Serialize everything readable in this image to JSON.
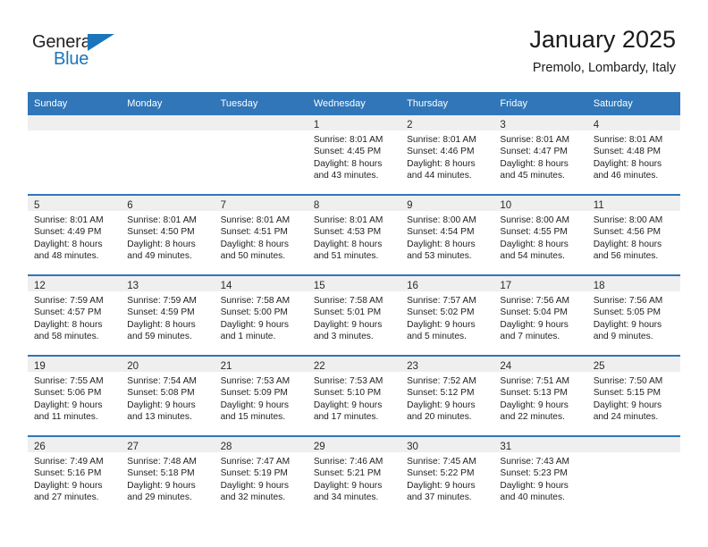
{
  "brand": {
    "name_part1": "General",
    "name_part2": "Blue",
    "logo_icon": "triangle-flag-icon",
    "accent_color": "#1b75bb"
  },
  "header": {
    "title": "January 2025",
    "location": "Premolo, Lombardy, Italy"
  },
  "theme": {
    "header_blue": "#3076b8",
    "daynum_band": "#efeff0",
    "text": "#1f1f1f"
  },
  "weekdays": [
    "Sunday",
    "Monday",
    "Tuesday",
    "Wednesday",
    "Thursday",
    "Friday",
    "Saturday"
  ],
  "weeks": [
    [
      {
        "day": "",
        "lines": [
          "",
          "",
          "",
          ""
        ]
      },
      {
        "day": "",
        "lines": [
          "",
          "",
          "",
          ""
        ]
      },
      {
        "day": "",
        "lines": [
          "",
          "",
          "",
          ""
        ]
      },
      {
        "day": "1",
        "lines": [
          "Sunrise: 8:01 AM",
          "Sunset: 4:45 PM",
          "Daylight: 8 hours",
          "and 43 minutes."
        ]
      },
      {
        "day": "2",
        "lines": [
          "Sunrise: 8:01 AM",
          "Sunset: 4:46 PM",
          "Daylight: 8 hours",
          "and 44 minutes."
        ]
      },
      {
        "day": "3",
        "lines": [
          "Sunrise: 8:01 AM",
          "Sunset: 4:47 PM",
          "Daylight: 8 hours",
          "and 45 minutes."
        ]
      },
      {
        "day": "4",
        "lines": [
          "Sunrise: 8:01 AM",
          "Sunset: 4:48 PM",
          "Daylight: 8 hours",
          "and 46 minutes."
        ]
      }
    ],
    [
      {
        "day": "5",
        "lines": [
          "Sunrise: 8:01 AM",
          "Sunset: 4:49 PM",
          "Daylight: 8 hours",
          "and 48 minutes."
        ]
      },
      {
        "day": "6",
        "lines": [
          "Sunrise: 8:01 AM",
          "Sunset: 4:50 PM",
          "Daylight: 8 hours",
          "and 49 minutes."
        ]
      },
      {
        "day": "7",
        "lines": [
          "Sunrise: 8:01 AM",
          "Sunset: 4:51 PM",
          "Daylight: 8 hours",
          "and 50 minutes."
        ]
      },
      {
        "day": "8",
        "lines": [
          "Sunrise: 8:01 AM",
          "Sunset: 4:53 PM",
          "Daylight: 8 hours",
          "and 51 minutes."
        ]
      },
      {
        "day": "9",
        "lines": [
          "Sunrise: 8:00 AM",
          "Sunset: 4:54 PM",
          "Daylight: 8 hours",
          "and 53 minutes."
        ]
      },
      {
        "day": "10",
        "lines": [
          "Sunrise: 8:00 AM",
          "Sunset: 4:55 PM",
          "Daylight: 8 hours",
          "and 54 minutes."
        ]
      },
      {
        "day": "11",
        "lines": [
          "Sunrise: 8:00 AM",
          "Sunset: 4:56 PM",
          "Daylight: 8 hours",
          "and 56 minutes."
        ]
      }
    ],
    [
      {
        "day": "12",
        "lines": [
          "Sunrise: 7:59 AM",
          "Sunset: 4:57 PM",
          "Daylight: 8 hours",
          "and 58 minutes."
        ]
      },
      {
        "day": "13",
        "lines": [
          "Sunrise: 7:59 AM",
          "Sunset: 4:59 PM",
          "Daylight: 8 hours",
          "and 59 minutes."
        ]
      },
      {
        "day": "14",
        "lines": [
          "Sunrise: 7:58 AM",
          "Sunset: 5:00 PM",
          "Daylight: 9 hours",
          "and 1 minute."
        ]
      },
      {
        "day": "15",
        "lines": [
          "Sunrise: 7:58 AM",
          "Sunset: 5:01 PM",
          "Daylight: 9 hours",
          "and 3 minutes."
        ]
      },
      {
        "day": "16",
        "lines": [
          "Sunrise: 7:57 AM",
          "Sunset: 5:02 PM",
          "Daylight: 9 hours",
          "and 5 minutes."
        ]
      },
      {
        "day": "17",
        "lines": [
          "Sunrise: 7:56 AM",
          "Sunset: 5:04 PM",
          "Daylight: 9 hours",
          "and 7 minutes."
        ]
      },
      {
        "day": "18",
        "lines": [
          "Sunrise: 7:56 AM",
          "Sunset: 5:05 PM",
          "Daylight: 9 hours",
          "and 9 minutes."
        ]
      }
    ],
    [
      {
        "day": "19",
        "lines": [
          "Sunrise: 7:55 AM",
          "Sunset: 5:06 PM",
          "Daylight: 9 hours",
          "and 11 minutes."
        ]
      },
      {
        "day": "20",
        "lines": [
          "Sunrise: 7:54 AM",
          "Sunset: 5:08 PM",
          "Daylight: 9 hours",
          "and 13 minutes."
        ]
      },
      {
        "day": "21",
        "lines": [
          "Sunrise: 7:53 AM",
          "Sunset: 5:09 PM",
          "Daylight: 9 hours",
          "and 15 minutes."
        ]
      },
      {
        "day": "22",
        "lines": [
          "Sunrise: 7:53 AM",
          "Sunset: 5:10 PM",
          "Daylight: 9 hours",
          "and 17 minutes."
        ]
      },
      {
        "day": "23",
        "lines": [
          "Sunrise: 7:52 AM",
          "Sunset: 5:12 PM",
          "Daylight: 9 hours",
          "and 20 minutes."
        ]
      },
      {
        "day": "24",
        "lines": [
          "Sunrise: 7:51 AM",
          "Sunset: 5:13 PM",
          "Daylight: 9 hours",
          "and 22 minutes."
        ]
      },
      {
        "day": "25",
        "lines": [
          "Sunrise: 7:50 AM",
          "Sunset: 5:15 PM",
          "Daylight: 9 hours",
          "and 24 minutes."
        ]
      }
    ],
    [
      {
        "day": "26",
        "lines": [
          "Sunrise: 7:49 AM",
          "Sunset: 5:16 PM",
          "Daylight: 9 hours",
          "and 27 minutes."
        ]
      },
      {
        "day": "27",
        "lines": [
          "Sunrise: 7:48 AM",
          "Sunset: 5:18 PM",
          "Daylight: 9 hours",
          "and 29 minutes."
        ]
      },
      {
        "day": "28",
        "lines": [
          "Sunrise: 7:47 AM",
          "Sunset: 5:19 PM",
          "Daylight: 9 hours",
          "and 32 minutes."
        ]
      },
      {
        "day": "29",
        "lines": [
          "Sunrise: 7:46 AM",
          "Sunset: 5:21 PM",
          "Daylight: 9 hours",
          "and 34 minutes."
        ]
      },
      {
        "day": "30",
        "lines": [
          "Sunrise: 7:45 AM",
          "Sunset: 5:22 PM",
          "Daylight: 9 hours",
          "and 37 minutes."
        ]
      },
      {
        "day": "31",
        "lines": [
          "Sunrise: 7:43 AM",
          "Sunset: 5:23 PM",
          "Daylight: 9 hours",
          "and 40 minutes."
        ]
      },
      {
        "day": "",
        "lines": [
          "",
          "",
          "",
          ""
        ]
      }
    ]
  ]
}
